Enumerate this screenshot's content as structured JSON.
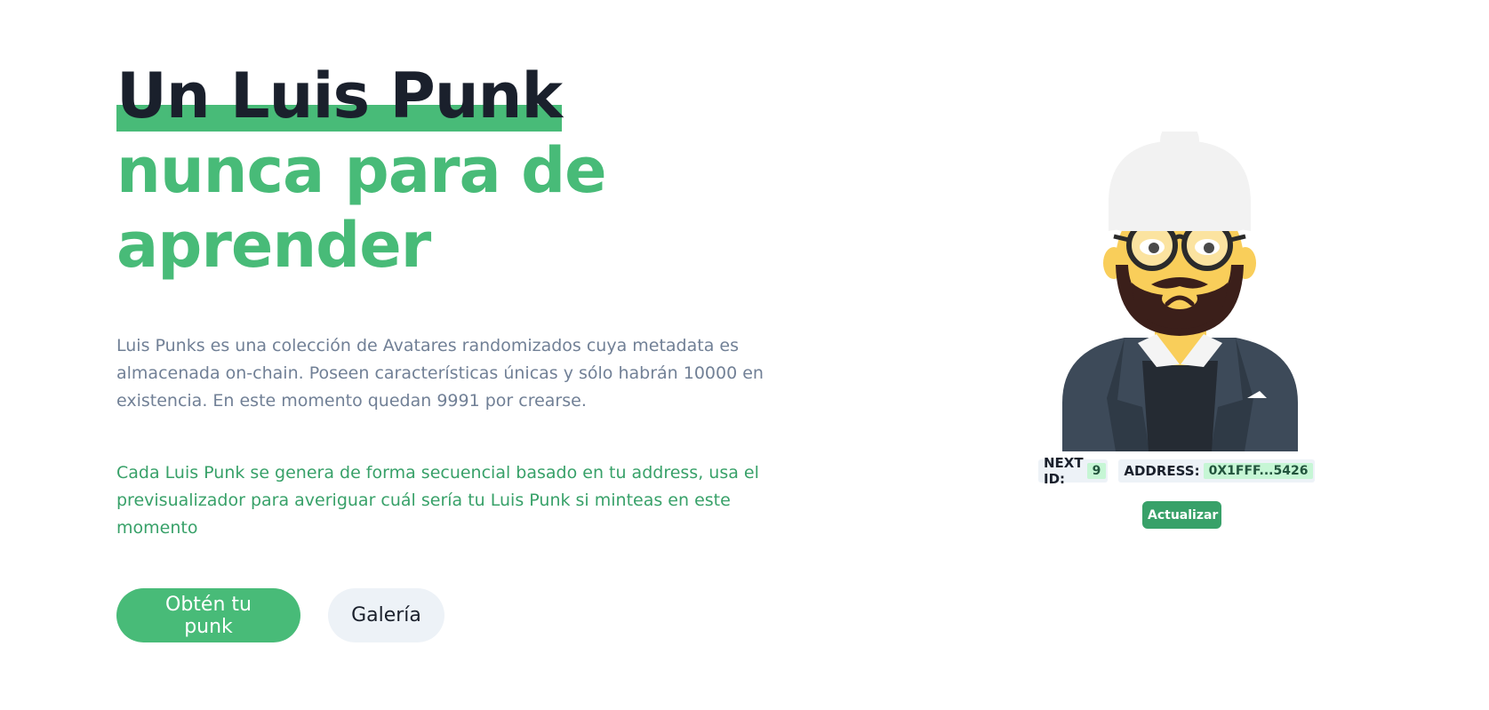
{
  "hero": {
    "title_line1": "Un Luis Punk",
    "title_line2": "nunca para de aprender",
    "description": "Luis Punks es una colección de Avatares randomizados cuya metadata es almacenada on-chain. Poseen características únicas y sólo habrán 10000 en existencia. En este momento quedan 9991 por crearse.",
    "description_green": "Cada Luis Punk se genera de forma secuencial basado en tu address, usa el previsualizador para averiguar cuál sería tu Luis Punk si minteas en este momento",
    "primary_button": "Obtén tu punk",
    "secondary_button": "Galería"
  },
  "preview": {
    "next_id_label": "NEXT ID:",
    "next_id_value": "9",
    "address_label": "ADDRESS:",
    "address_value": "0X1FFF...5426",
    "refresh_button": "Actualizar"
  },
  "colors": {
    "accent": "#48bb78",
    "accent_dark": "#38a169",
    "text_dark": "#1a202c",
    "text_muted": "#718096"
  }
}
